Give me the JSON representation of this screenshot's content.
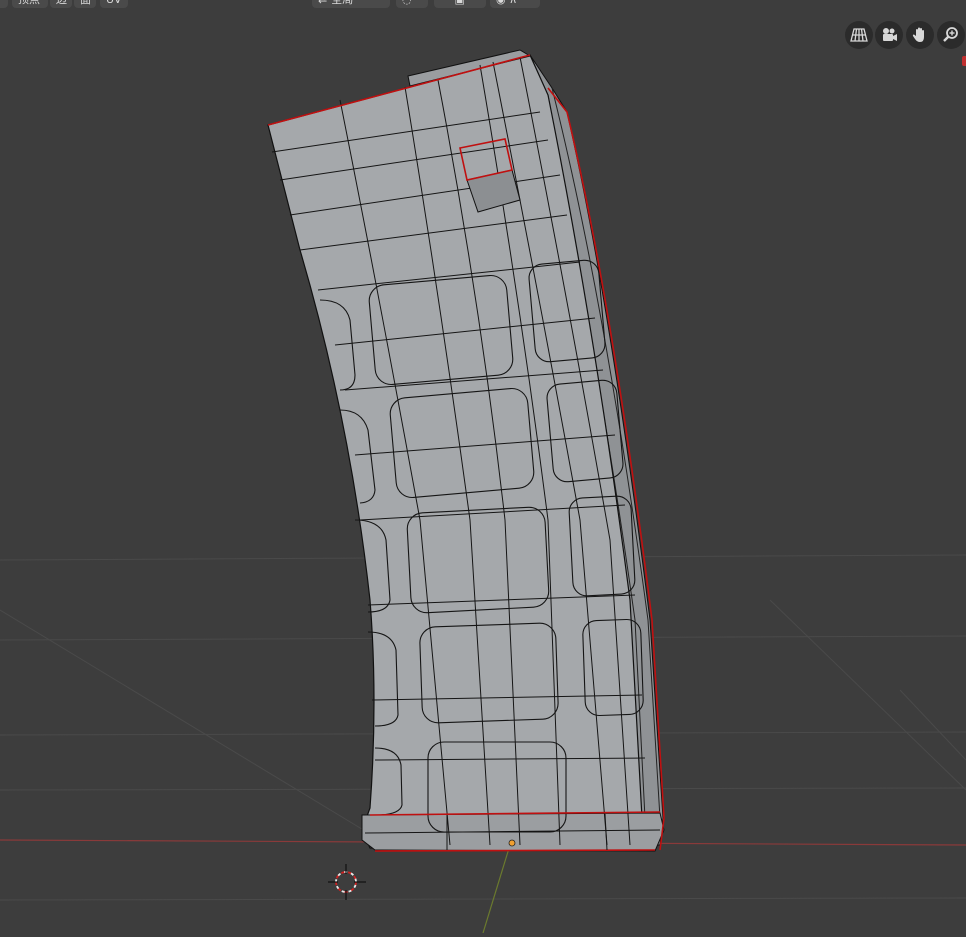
{
  "header": {
    "menu_items": [
      {
        "label": "顶点"
      },
      {
        "label": "边"
      },
      {
        "label": "面"
      },
      {
        "label": "UV"
      }
    ],
    "center_tools": [
      {
        "label": "全局",
        "icon": "transform-orientation-icon"
      },
      {
        "label": "",
        "icon": "pivot-point-icon"
      },
      {
        "label": "",
        "icon": "snap-icon"
      },
      {
        "label": "",
        "icon": "proportional-editing-icon"
      }
    ]
  },
  "nav_gizmo": [
    {
      "icon": "perspective-grid-icon"
    },
    {
      "icon": "camera-icon"
    },
    {
      "icon": "hand-pan-icon"
    },
    {
      "icon": "zoom-icon"
    }
  ],
  "colors": {
    "background": "#3d3d3d",
    "grid": "#4a4a4a",
    "x_axis": "#8a3a3a",
    "y_axis": "#6b7a2e",
    "mesh_fill": "#a5a8ab",
    "mesh_wire": "#111111",
    "seam": "#c01010",
    "cursor": "#e0e0e0",
    "origin": "#f0a030"
  }
}
